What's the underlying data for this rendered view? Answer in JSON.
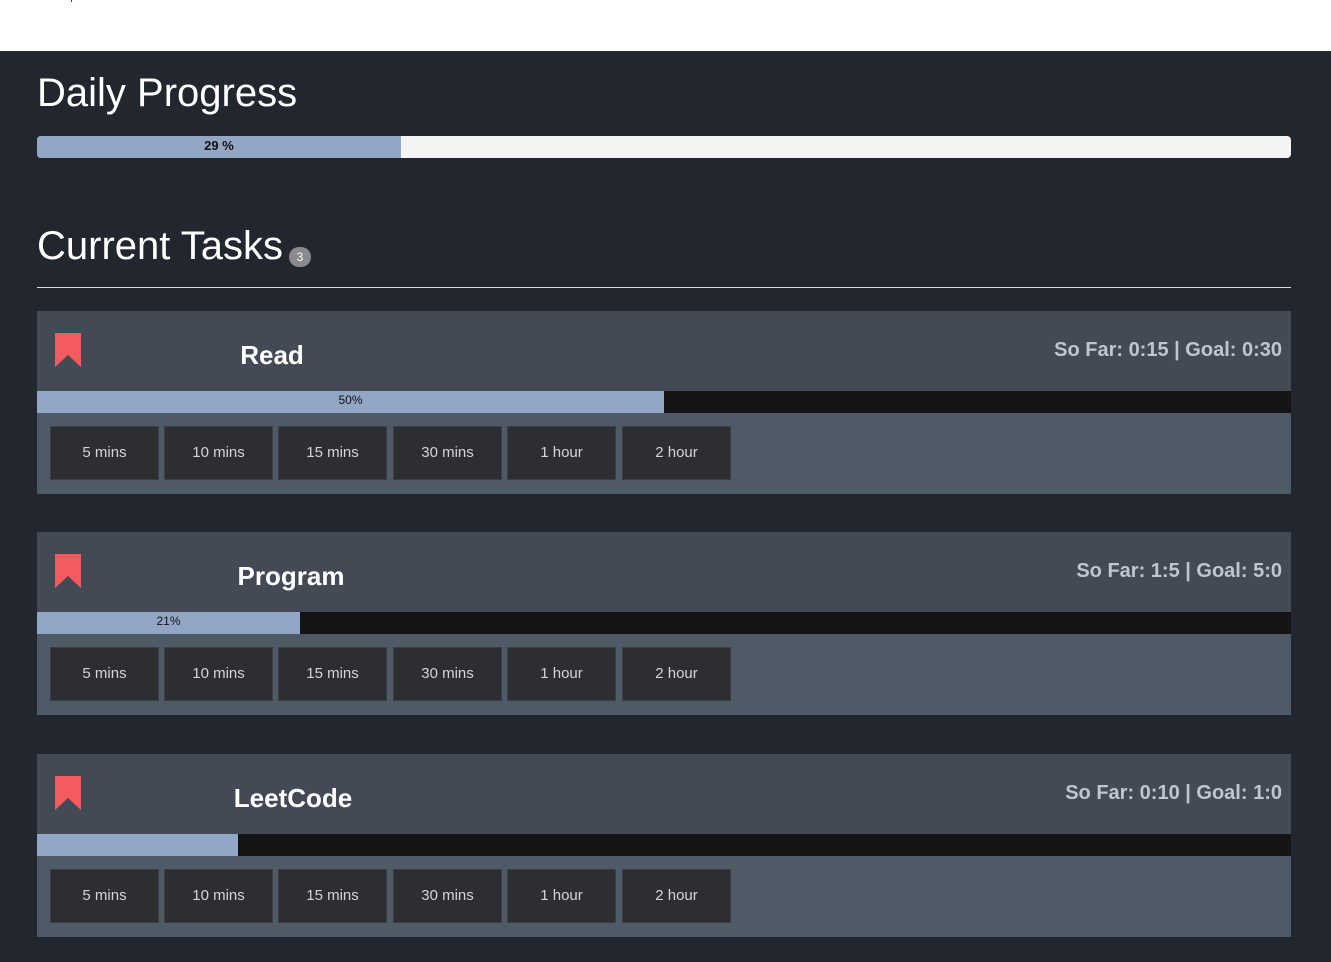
{
  "colors": {
    "page_bg": "#22262e",
    "task_header_bg": "#434a55",
    "task_body_bg": "#4f5a67",
    "progress_fill": "#94a6c6",
    "bookmark": "#f45b5f",
    "button_bg": "#2d2e31"
  },
  "daily": {
    "title": "Daily Progress",
    "progress_fraction": 0.29,
    "progress_label": "29 %"
  },
  "tasks_section": {
    "title": "Current Tasks",
    "count": "3"
  },
  "tasks": [
    {
      "icon": "bookmark-icon",
      "name": "Read",
      "stats": "So Far: 0:15 | Goal: 0:30",
      "progress_fraction": 0.5,
      "progress_label": "50%",
      "buttons": [
        "5 mins",
        "10 mins",
        "15 mins",
        "30 mins",
        "1 hour",
        "2 hour"
      ]
    },
    {
      "icon": "bookmark-icon",
      "name": "Program",
      "stats": "So Far: 1:5 | Goal: 5:0",
      "progress_fraction": 0.21,
      "progress_label": "21%",
      "buttons": [
        "5 mins",
        "10 mins",
        "15 mins",
        "30 mins",
        "1 hour",
        "2 hour"
      ]
    },
    {
      "icon": "bookmark-icon",
      "name": "LeetCode",
      "stats": "So Far: 0:10 | Goal: 1:0",
      "progress_fraction": 0.16,
      "progress_label": "",
      "buttons": [
        "5 mins",
        "10 mins",
        "15 mins",
        "30 mins",
        "1 hour",
        "2 hour"
      ]
    }
  ]
}
